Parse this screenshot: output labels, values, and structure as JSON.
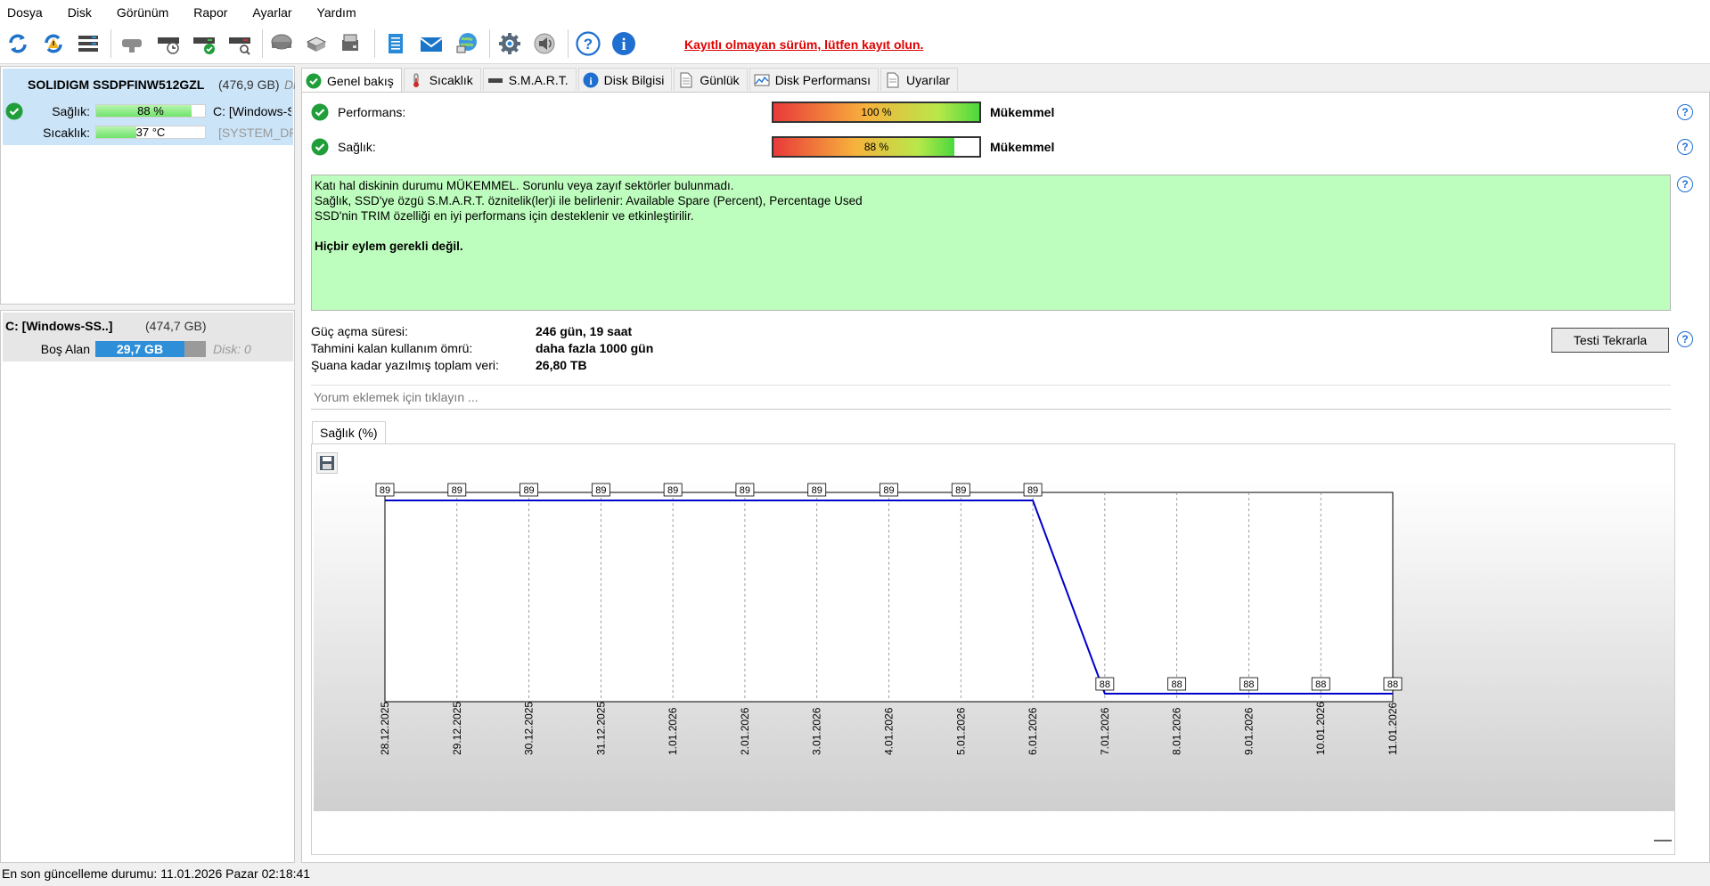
{
  "menu": [
    "Dosya",
    "Disk",
    "Görünüm",
    "Rapor",
    "Ayarlar",
    "Yardım"
  ],
  "toolbar": {
    "icons": [
      "refresh-icon",
      "refresh-warning-icon",
      "disk-list-icon",
      "disk-grey-icon",
      "disk-schedule-icon",
      "disk-ok-icon",
      "disk-search-icon",
      "hdd-icon",
      "disk-export-icon",
      "disk-tools-icon",
      "notes-icon",
      "mail-icon",
      "network-icon",
      "gear-icon",
      "speaker-icon",
      "help-icon",
      "info-icon"
    ],
    "register_link": "Kayıtlı olmayan sürüm, lütfen kayıt olun."
  },
  "disk": {
    "name": "SOLIDIGM SSDPFINW512GZL",
    "size": "(476,9 GB)",
    "extra": "Di",
    "health_label": "Sağlık:",
    "health_value": "88 %",
    "health_fraction": 0.88,
    "temp_label": "Sıcaklık:",
    "temp_value": "37 °C",
    "temp_fraction": 0.37,
    "vol1": "C: [Windows-SS..]",
    "vol2": "[SYSTEM_DRV]"
  },
  "volume": {
    "name": "C: [Windows-SS..]",
    "size": "(474,7 GB)",
    "free_label": "Boş Alan",
    "free_value": "29,7 GB",
    "used_fraction": 0.81,
    "disk_label": "Disk: 0"
  },
  "tabs": [
    "Genel bakış",
    "Sıcaklık",
    "S.M.A.R.T.",
    "Disk Bilgisi",
    "Günlük",
    "Disk Performansı",
    "Uyarılar"
  ],
  "overview": {
    "perf_label": "Performans:",
    "perf_value": "100 %",
    "perf_fraction": 1.0,
    "perf_status": "Mükemmel",
    "health_label": "Sağlık:",
    "health_value": "88 %",
    "health_fraction": 0.88,
    "health_status": "Mükemmel",
    "status_lines": [
      "Katı hal diskinin durumu MÜKEMMEL. Sorunlu veya zayıf sektörler bulunmadı.",
      "Sağlık, SSD'ye özgü S.M.A.R.T. öznitelik(ler)i ile belirlenir:  Available Spare (Percent), Percentage Used",
      "SSD'nin TRIM özelliği en iyi performans için desteklenir ve etkinleştirilir."
    ],
    "action_line": "Hiçbir eylem gerekli değil.",
    "power_on_label": "Güç açma süresi:",
    "power_on_value": "246 gün, 19 saat",
    "lifetime_label": "Tahmini kalan kullanım ömrü:",
    "lifetime_value": "daha fazla 1000 gün",
    "written_label": "Şuana kadar yazılmış toplam veri:",
    "written_value": "26,80 TB",
    "retest_button": "Testi Tekrarla",
    "comment_placeholder": "Yorum eklemek için tıklayın ..."
  },
  "chart_tab": "Sağlık (%)",
  "chart_data": {
    "type": "line",
    "categories": [
      "28.12.2025",
      "29.12.2025",
      "30.12.2025",
      "31.12.2025",
      "1.01.2026",
      "2.01.2026",
      "3.01.2026",
      "4.01.2026",
      "5.01.2026",
      "6.01.2026",
      "7.01.2026",
      "8.01.2026",
      "9.01.2026",
      "10.01.2026",
      "11.01.2026"
    ],
    "values": [
      89,
      89,
      89,
      89,
      89,
      89,
      89,
      89,
      89,
      89,
      88,
      88,
      88,
      88,
      88
    ],
    "ylim": [
      88,
      89
    ],
    "grid": "vertical",
    "line_color": "#0000cc"
  },
  "statusbar": "En son güncelleme durumu: 11.01.2026 Pazar 02:18:41"
}
